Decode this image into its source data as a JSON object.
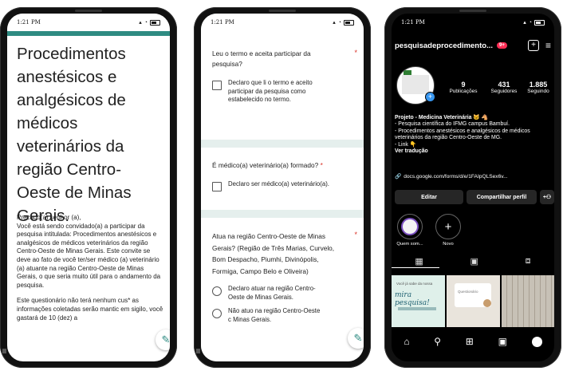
{
  "phone1": {
    "time": "1:21 PM",
    "title": "Procedimentos anestésicos e analgésicos de médicos veterinários da região Centro-Oeste de Minas Gerais.",
    "greeting": "Prezado(a) senhor (a),",
    "paragraph1": "Você está sendo convidado(a) a participar da pesquisa intitulada: Procedimentos anestésicos e analgésicos de médicos veterinários da região Centro-Oeste de Minas Gerais. Este convite se deve ao fato de você ter/ser médico (a) veterinário (a) atuante na região Centro-Oeste de Minas Gerais, o que seria muito útil para o andamento da pesquisa.",
    "paragraph2": "Este questionário não terá nenhum cus* as informações coletadas serão mantic em sigilo, você gastará de 10 (dez) a",
    "edit_icon": "pencil-icon"
  },
  "phone2": {
    "time": "1:21 PM",
    "q1": "Leu o termo e aceita participar da pesquisa?",
    "q1_option": "Declaro que li o termo e aceito participar da pesquisa como estabelecido no termo.",
    "q2": "É médico(a) veterinário(a) formado?",
    "q2_option": "Declaro ser médico(a) veterinário(a).",
    "q3": "Atua na região Centro-Oeste de Minas Gerais? (Região de Três Marias, Curvelo, Bom Despacho, Piumhi, Divinópolis, Formiga, Campo Belo e Oliveira)",
    "q3_option1": "Declaro atuar na região Centro-Oeste de Minas Gerais.",
    "q3_option2": "Não atuo na região Centro-Oeste c Minas Gerais.",
    "required_mark": "*"
  },
  "phone3": {
    "time": "1:21 PM",
    "username": "pesquisadeprocedimento...",
    "badge": "9+",
    "stats": [
      {
        "value": "9",
        "label": "Publicações"
      },
      {
        "value": "431",
        "label": "Seguidores"
      },
      {
        "value": "1.885",
        "label": "Seguindo"
      }
    ],
    "bio_title": "Projeto - Medicina Veterinária 🐱 🐴",
    "bio_line1": "- Pesquisa científica do IFMG campus Bambuí.",
    "bio_line2": "- Procedimentos anestésicos e analgésicos de médicos veterinários da região Centro-Oeste de MG.",
    "bio_line3": "- Link 👇",
    "translation": "Ver tradução",
    "link": "docs.google.com/forms/d/e/1FAIpQLSex6v...",
    "edit_button": "Editar",
    "share_button": "Compartilhar perfil",
    "highlight1": "Quem som...",
    "highlight2": "Novo",
    "post1_text": "mira pesquisa!",
    "post1_small": "Você já sabe da nossa",
    "post2_small": "Questionário",
    "accent": "#3897f0"
  }
}
